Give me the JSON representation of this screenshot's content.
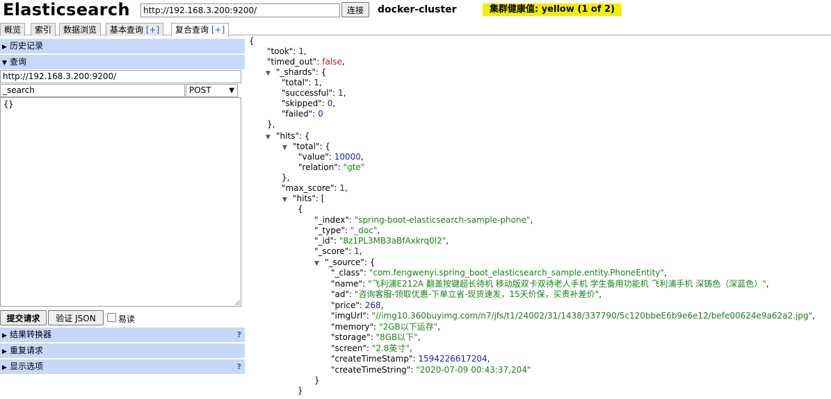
{
  "header": {
    "app_title": "Elasticsearch",
    "url_value": "http://192.168.3.200:9200/",
    "connect_label": "连接",
    "cluster_name": "docker-cluster",
    "health": "集群健康值: yellow (1 of 2)"
  },
  "tabs": [
    {
      "label": "概览"
    },
    {
      "label": "索引"
    },
    {
      "label": "数据浏览"
    },
    {
      "label": "基本查询",
      "suffix": "[+]"
    },
    {
      "label": "复合查询",
      "suffix": "[+]",
      "active": true
    }
  ],
  "left": {
    "history_label": "历史记录",
    "query_label": "查询",
    "query_url": "http://192.168.3.200:9200/",
    "query_path": "_search",
    "method": "POST",
    "body": "{}",
    "submit_label": "提交请求",
    "validate_label": "验证 JSON",
    "readonly_label": "易读",
    "result_transformer_label": "结果转换器",
    "repeat_request_label": "重复请求",
    "display_options_label": "显示选项",
    "help_mark": "?"
  },
  "json_lines": [
    {
      "t": "{"
    },
    {
      "k": "\"took\"",
      "v": "1",
      "vt": "num",
      "tail": ","
    },
    {
      "k": "\"timed_out\"",
      "v": "false",
      "vt": "bool",
      "tail": ","
    },
    {
      "arrow": "▼",
      "k": "\"_shards\"",
      "tail": " {"
    },
    {
      "k": "\"total\"",
      "v": "1",
      "vt": "num",
      "tail": ","
    },
    {
      "k": "\"successful\"",
      "v": "1",
      "vt": "num",
      "tail": ","
    },
    {
      "k": "\"skipped\"",
      "v": "0",
      "vt": "num",
      "tail": ","
    },
    {
      "k": "\"failed\"",
      "v": "0",
      "vt": "num",
      "tail": ""
    },
    {
      "t": "},"
    },
    {
      "arrow": "▼",
      "k": "\"hits\"",
      "tail": " {"
    },
    {
      "arrow": "▼",
      "k": "\"total\"",
      "tail": " {"
    },
    {
      "k": "\"value\"",
      "v": "10000",
      "vt": "num",
      "tail": ","
    },
    {
      "k": "\"relation\"",
      "v": "\"gte\"",
      "vt": "str",
      "tail": ""
    },
    {
      "t": "},"
    },
    {
      "k": "\"max_score\"",
      "v": "1",
      "vt": "num",
      "tail": ","
    },
    {
      "arrow": "▼",
      "k": "\"hits\"",
      "tail": " ["
    },
    {
      "t": "{"
    },
    {
      "k": "\"_index\"",
      "v": "\"spring-boot-elasticsearch-sample-phone\"",
      "vt": "str",
      "tail": ","
    },
    {
      "k": "\"_type\"",
      "v": "\"_doc\"",
      "vt": "str",
      "tail": ","
    },
    {
      "k": "\"_id\"",
      "v": "\"8z1PL3MB3aBfAxkrq0l2\"",
      "vt": "str",
      "tail": ","
    },
    {
      "k": "\"_score\"",
      "v": "1",
      "vt": "num",
      "tail": ","
    },
    {
      "arrow": "▼",
      "k": "\"_source\"",
      "tail": " {"
    },
    {
      "k": "\"_class\"",
      "v": "\"com.fengwenyi.spring_boot_elasticsearch_sample.entity.PhoneEntity\"",
      "vt": "str",
      "tail": ","
    },
    {
      "k": "\"name\"",
      "v": "\"飞利浦E212A 翻盖按键超长待机 移动版双卡双待老人手机 学生备用功能机 飞利浦手机 深铸色（深蓝色）\"",
      "vt": "str",
      "tail": ","
    },
    {
      "k": "\"ad\"",
      "v": "\"咨询客服-领取优惠-下单立省-现货速发，15天价保，买贵补差价\"",
      "vt": "str",
      "tail": ","
    },
    {
      "k": "\"price\"",
      "v": "268",
      "vt": "num",
      "tail": ","
    },
    {
      "k": "\"imgUrl\"",
      "v": "\"//img10.360buyimg.com/n7/jfs/t1/24002/31/1438/337790/5c120bbeE6b9e6e12/befe00624e9a62a2.jpg\"",
      "vt": "str",
      "tail": ","
    },
    {
      "k": "\"memory\"",
      "v": "\"2GB以下运存\"",
      "vt": "str",
      "tail": ","
    },
    {
      "k": "\"storage\"",
      "v": "\"8GB以下\"",
      "vt": "str",
      "tail": ","
    },
    {
      "k": "\"screen\"",
      "v": "\"2.8英寸\"",
      "vt": "str",
      "tail": ","
    },
    {
      "k": "\"createTimeStamp\"",
      "v": "1594226617204",
      "vt": "num",
      "tail": ","
    },
    {
      "k": "\"createTimeString\"",
      "v": "\"2020-07-09 00:43:37,204\"",
      "vt": "str",
      "tail": ""
    },
    {
      "t": "}"
    },
    {
      "t": "}"
    }
  ]
}
